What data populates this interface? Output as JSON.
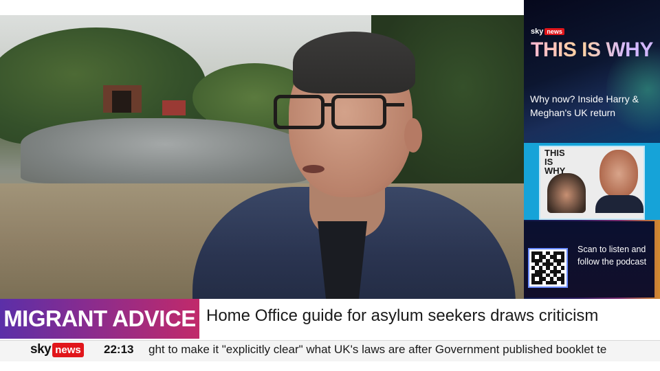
{
  "promo": {
    "brand_sky": "sky",
    "brand_news": "news",
    "title": "THIS IS WHY",
    "teaser": "Why now? Inside Harry & Meghan's UK return",
    "thumbnail_title": "THIS IS WHY",
    "qr_text": "Scan to listen and follow the podcast"
  },
  "lower_third": {
    "label": "MIGRANT ADVICE",
    "headline": "Home Office guide for asylum seekers draws criticism"
  },
  "ticker": {
    "logo_sky": "sky",
    "logo_news": "news",
    "time": "22:13",
    "text": "ght to make it \"explicitly clear\" what UK's laws are after Government published booklet te"
  },
  "colors": {
    "label_gradient_start": "#5b2fa8",
    "label_gradient_end": "#c12a6a",
    "news_red": "#e1161b",
    "promo_background": "#05081c"
  }
}
